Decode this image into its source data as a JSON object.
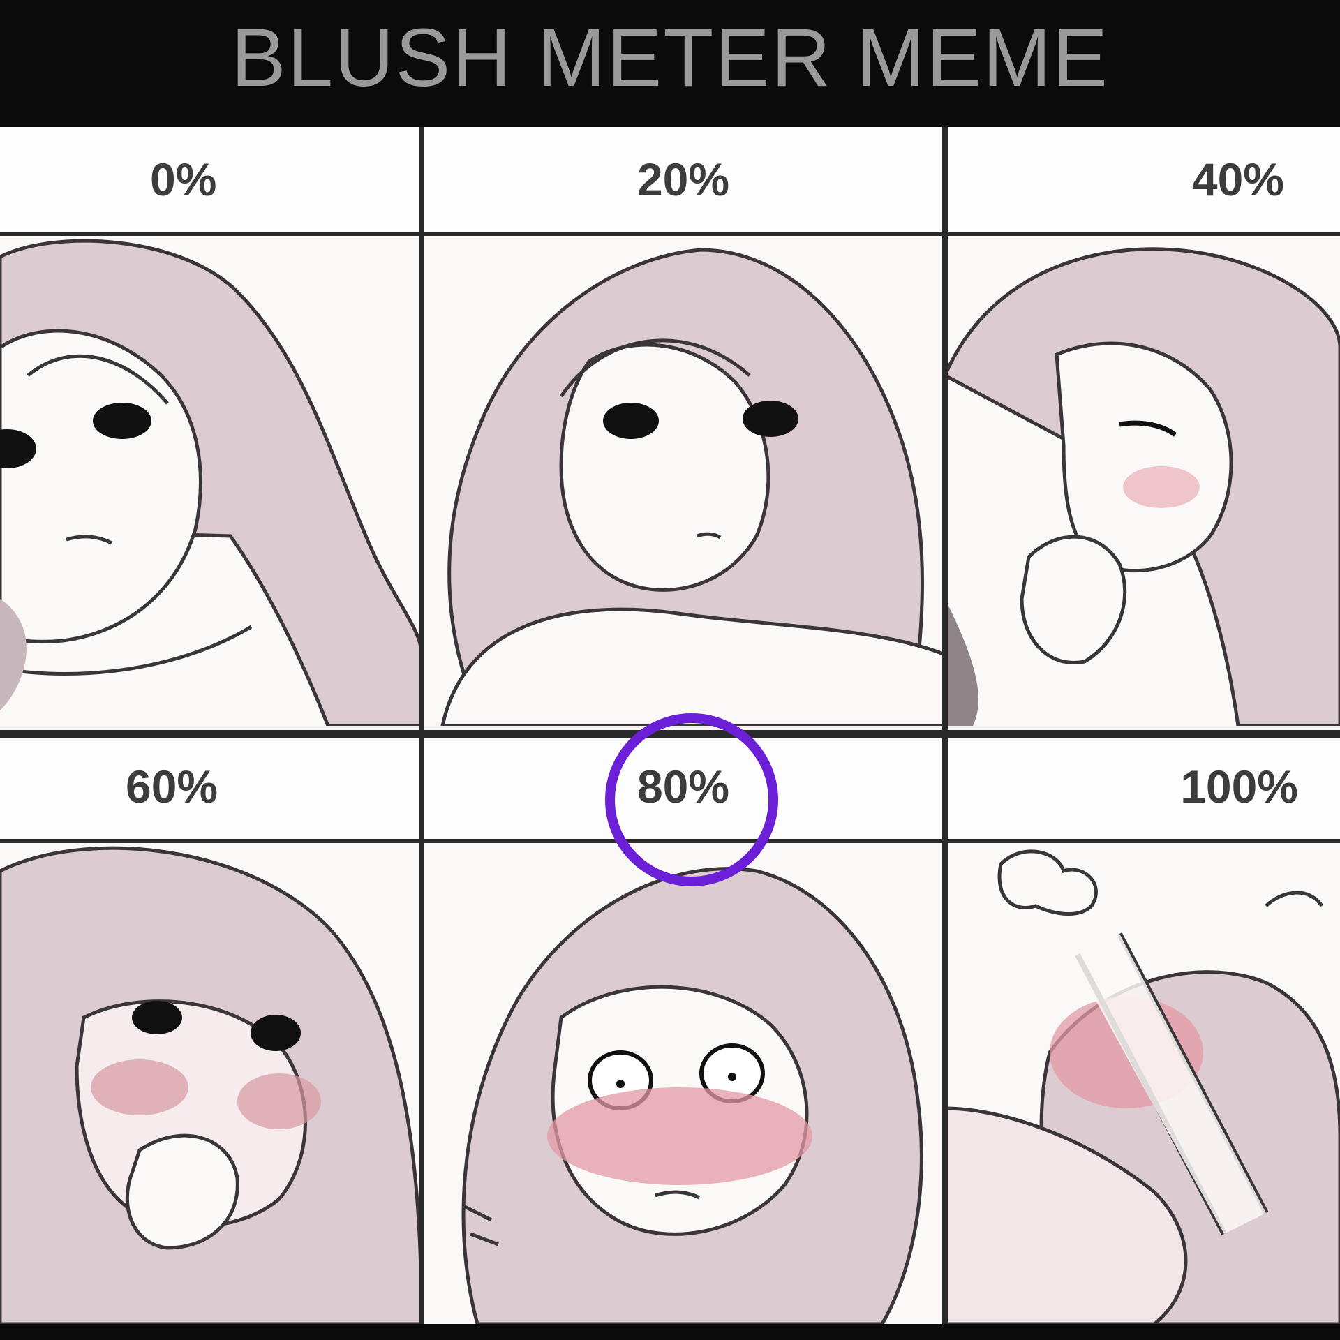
{
  "title": "BLUSH METER MEME",
  "panels": [
    {
      "label": "0%"
    },
    {
      "label": "20%"
    },
    {
      "label": "40%"
    },
    {
      "label": "60%"
    },
    {
      "label": "80%"
    },
    {
      "label": "100%"
    }
  ],
  "highlighted_panel": "80%",
  "colors": {
    "header_bg": "#0b0b0b",
    "title_text": "#9a9a9a",
    "hair": "#d9c9cf",
    "skin": "#fbf8f8",
    "line": "#3a3538",
    "blush": "#e8a3ab",
    "highlight_circle": "#6b1fd6"
  }
}
